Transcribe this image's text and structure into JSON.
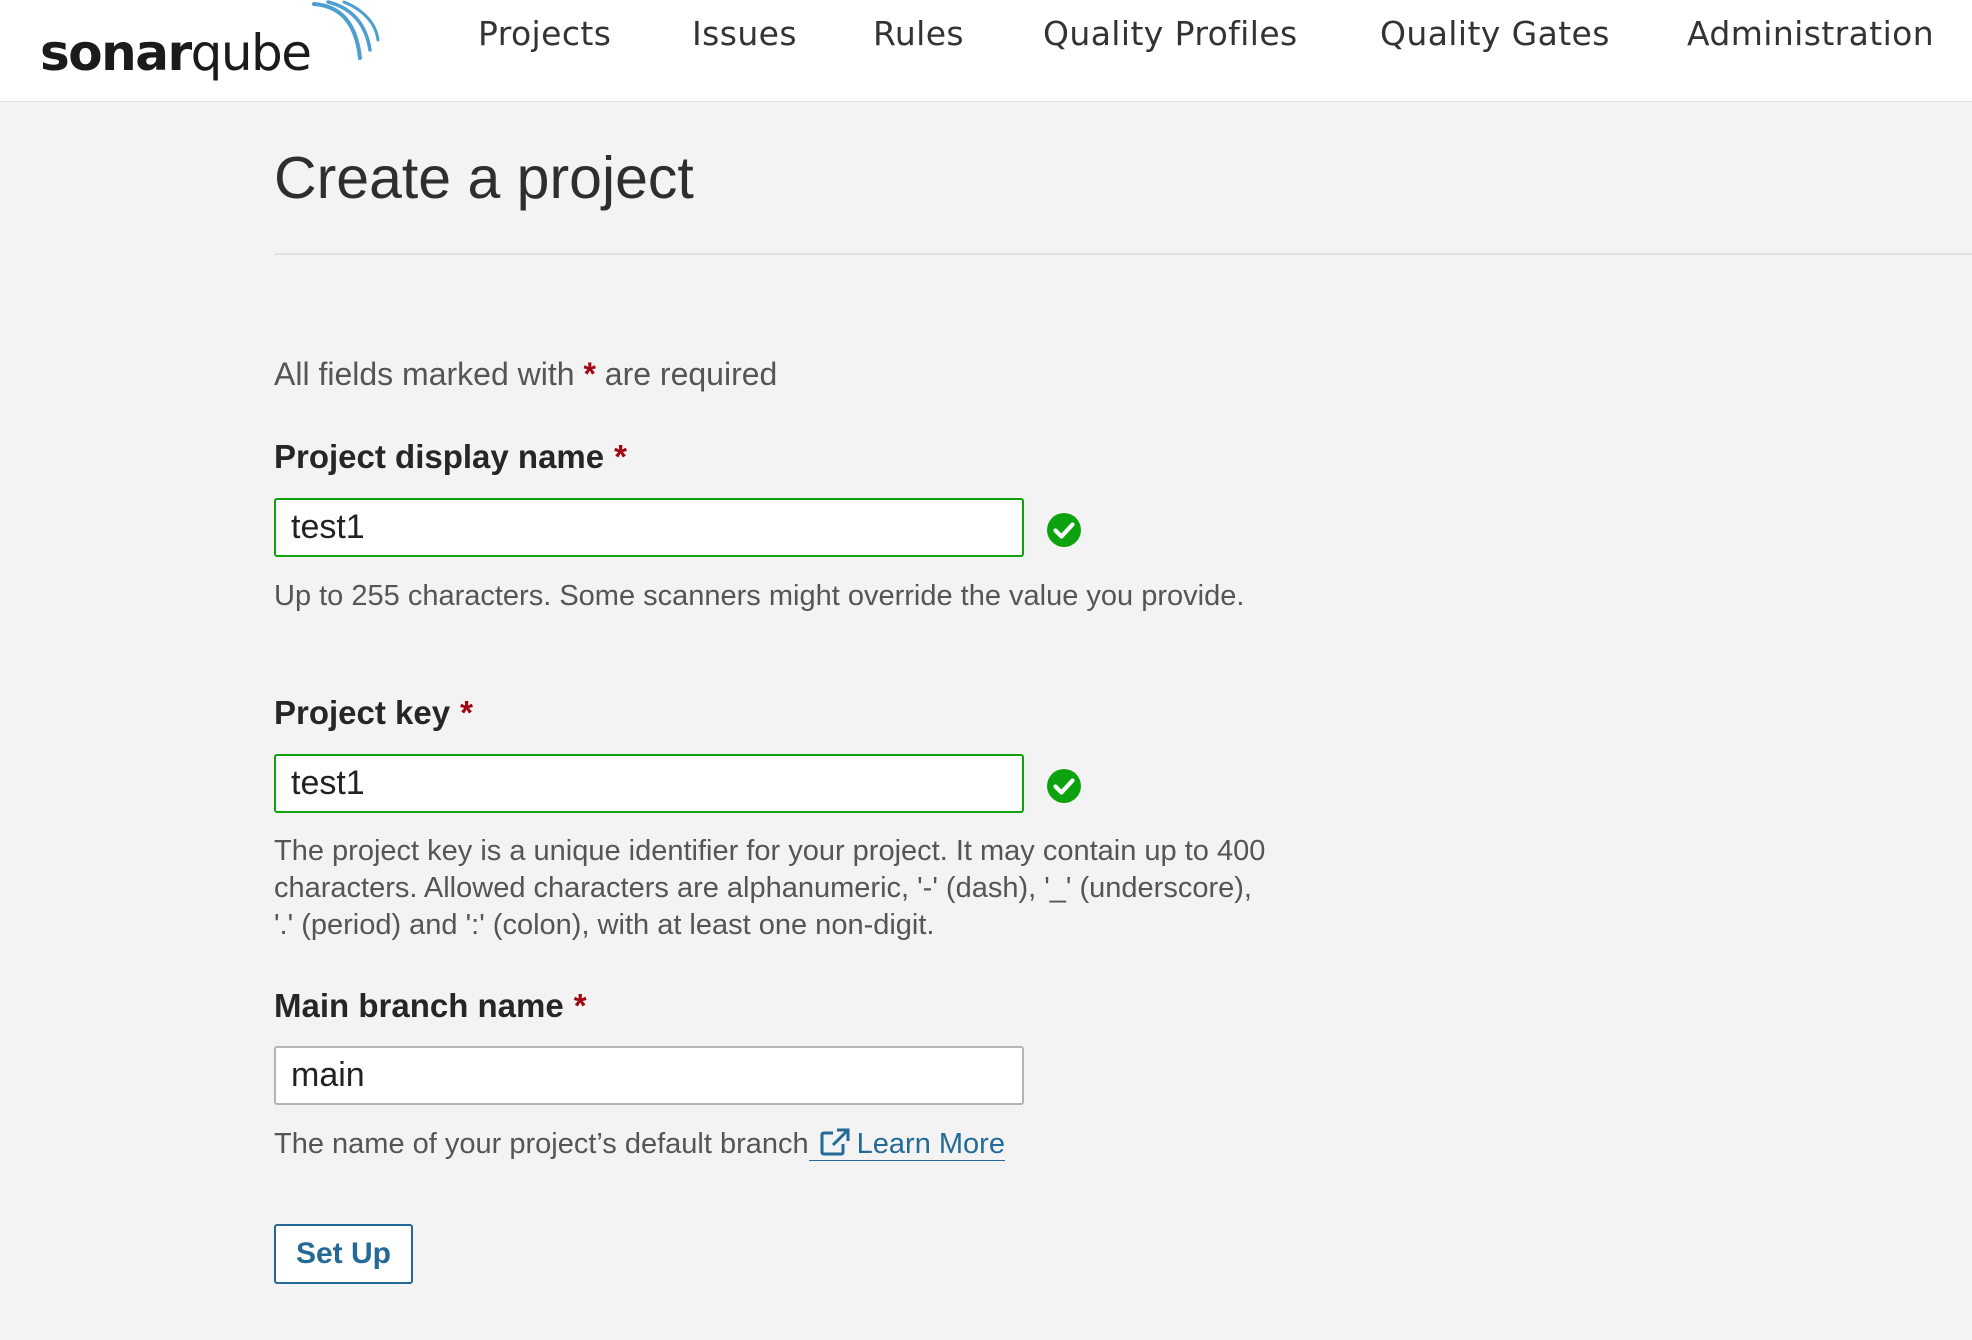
{
  "header": {
    "logo": {
      "text_bold": "sonar",
      "text_regular": "qube",
      "icon": "sonar-waves-icon"
    },
    "nav": [
      {
        "label": "Projects"
      },
      {
        "label": "Issues"
      },
      {
        "label": "Rules"
      },
      {
        "label": "Quality Profiles"
      },
      {
        "label": "Quality Gates"
      },
      {
        "label": "Administration"
      }
    ]
  },
  "page": {
    "title": "Create a project",
    "required_note_prefix": "All fields marked with",
    "required_note_asterisk": "*",
    "required_note_suffix": "are required"
  },
  "form": {
    "display_name": {
      "label": "Project display name",
      "required_mark": "*",
      "value": "test1",
      "status_icon": "check-circle-icon",
      "help": "Up to 255 characters. Some scanners might override the value you provide."
    },
    "project_key": {
      "label": "Project key",
      "required_mark": "*",
      "value": "test1",
      "status_icon": "check-circle-icon",
      "help": "The project key is a unique identifier for your project. It may contain up to 400 characters. Allowed characters are alphanumeric, '-' (dash), '_' (underscore), '.' (period) and ':' (colon), with at least one non-digit."
    },
    "main_branch": {
      "label": "Main branch name",
      "required_mark": "*",
      "value": "main",
      "help": "The name of your project’s default branch",
      "link_label": "Learn More",
      "link_icon": "external-link-icon"
    },
    "submit_label": "Set Up"
  },
  "colors": {
    "accent": "#236a97",
    "valid": "#0ea30e",
    "required": "#a4030f",
    "background": "#f3f3f3"
  }
}
